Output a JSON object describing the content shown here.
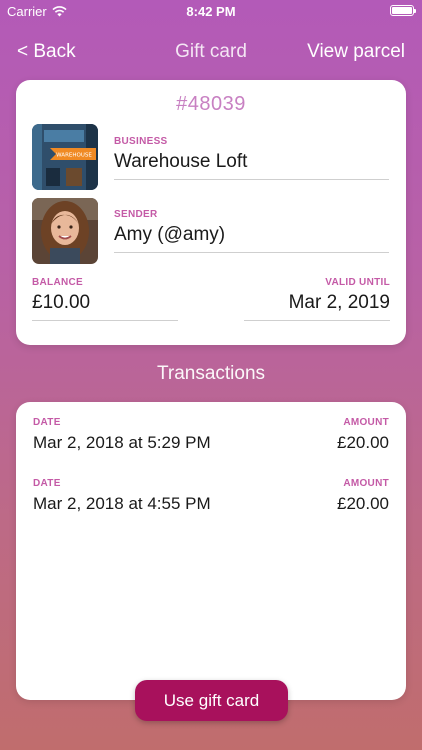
{
  "status_bar": {
    "carrier": "Carrier",
    "time": "8:42 PM"
  },
  "nav": {
    "back_label": "< Back",
    "title": "Gift card",
    "right_label": "View parcel"
  },
  "gift_card": {
    "id": "#48039",
    "business": {
      "label": "BUSINESS",
      "value": "Warehouse Loft",
      "logo_text": "WAREHOUSE"
    },
    "sender": {
      "label": "SENDER",
      "value": "Amy (@amy)"
    },
    "balance": {
      "label": "BALANCE",
      "value": "£10.00"
    },
    "valid_until": {
      "label": "VALID UNTIL",
      "value": "Mar 2, 2019"
    }
  },
  "transactions": {
    "title": "Transactions",
    "rows": [
      {
        "date_label": "DATE",
        "date": "Mar 2, 2018 at 5:29 PM",
        "amount_label": "AMOUNT",
        "amount": "£20.00"
      },
      {
        "date_label": "DATE",
        "date": "Mar 2, 2018 at 4:55 PM",
        "amount_label": "AMOUNT",
        "amount": "£20.00"
      }
    ]
  },
  "actions": {
    "use_label": "Use gift card"
  },
  "colors": {
    "accent": "#c45aa6",
    "button": "#a8115c",
    "card_id": "#c880c2"
  }
}
